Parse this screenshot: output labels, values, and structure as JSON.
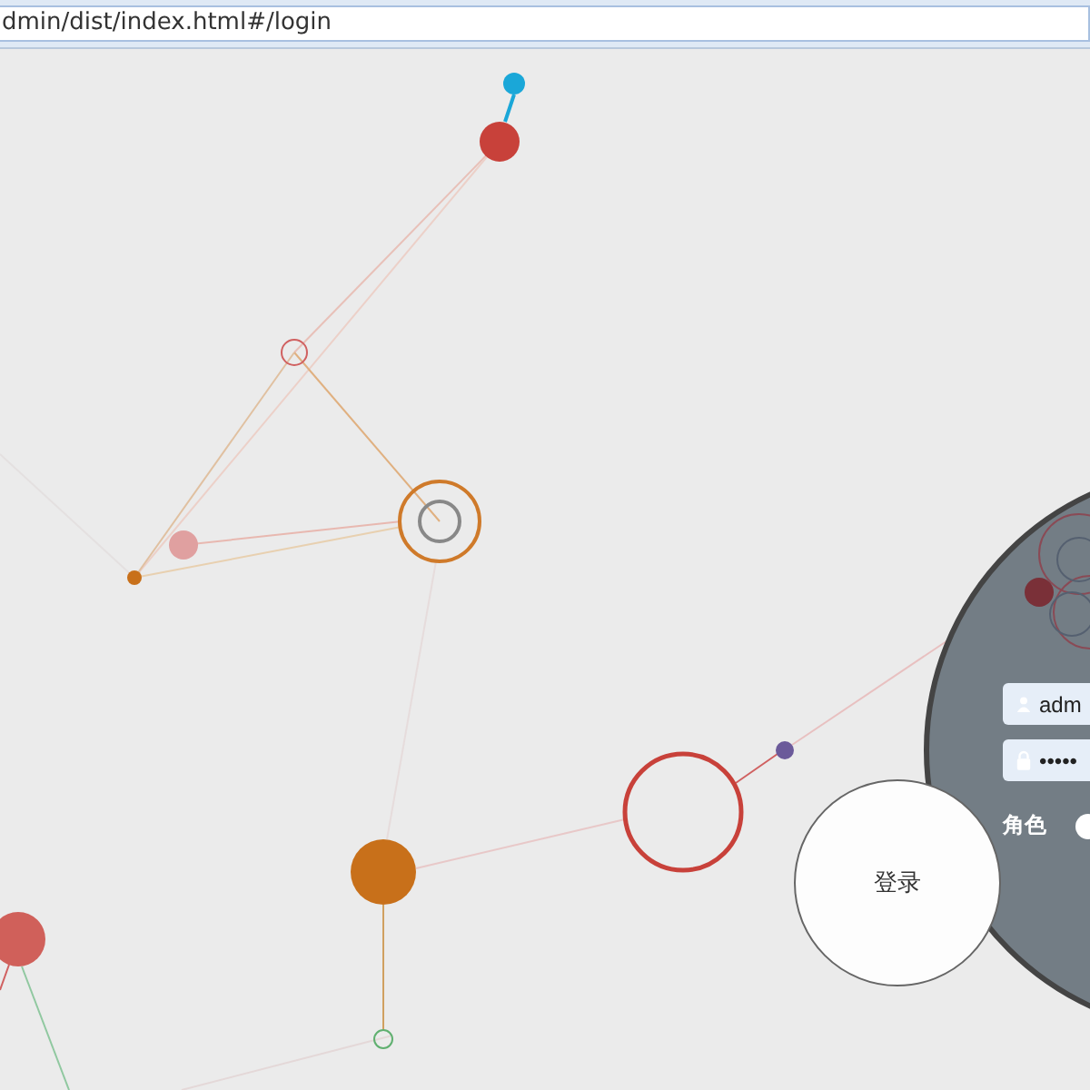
{
  "browser": {
    "address": "dmin/dist/index.html#/login"
  },
  "login": {
    "username": {
      "value": "adm"
    },
    "password": {
      "value": "•••••"
    },
    "role_label": "角色",
    "role_option": {
      "selected": false
    },
    "submit": "登录"
  }
}
